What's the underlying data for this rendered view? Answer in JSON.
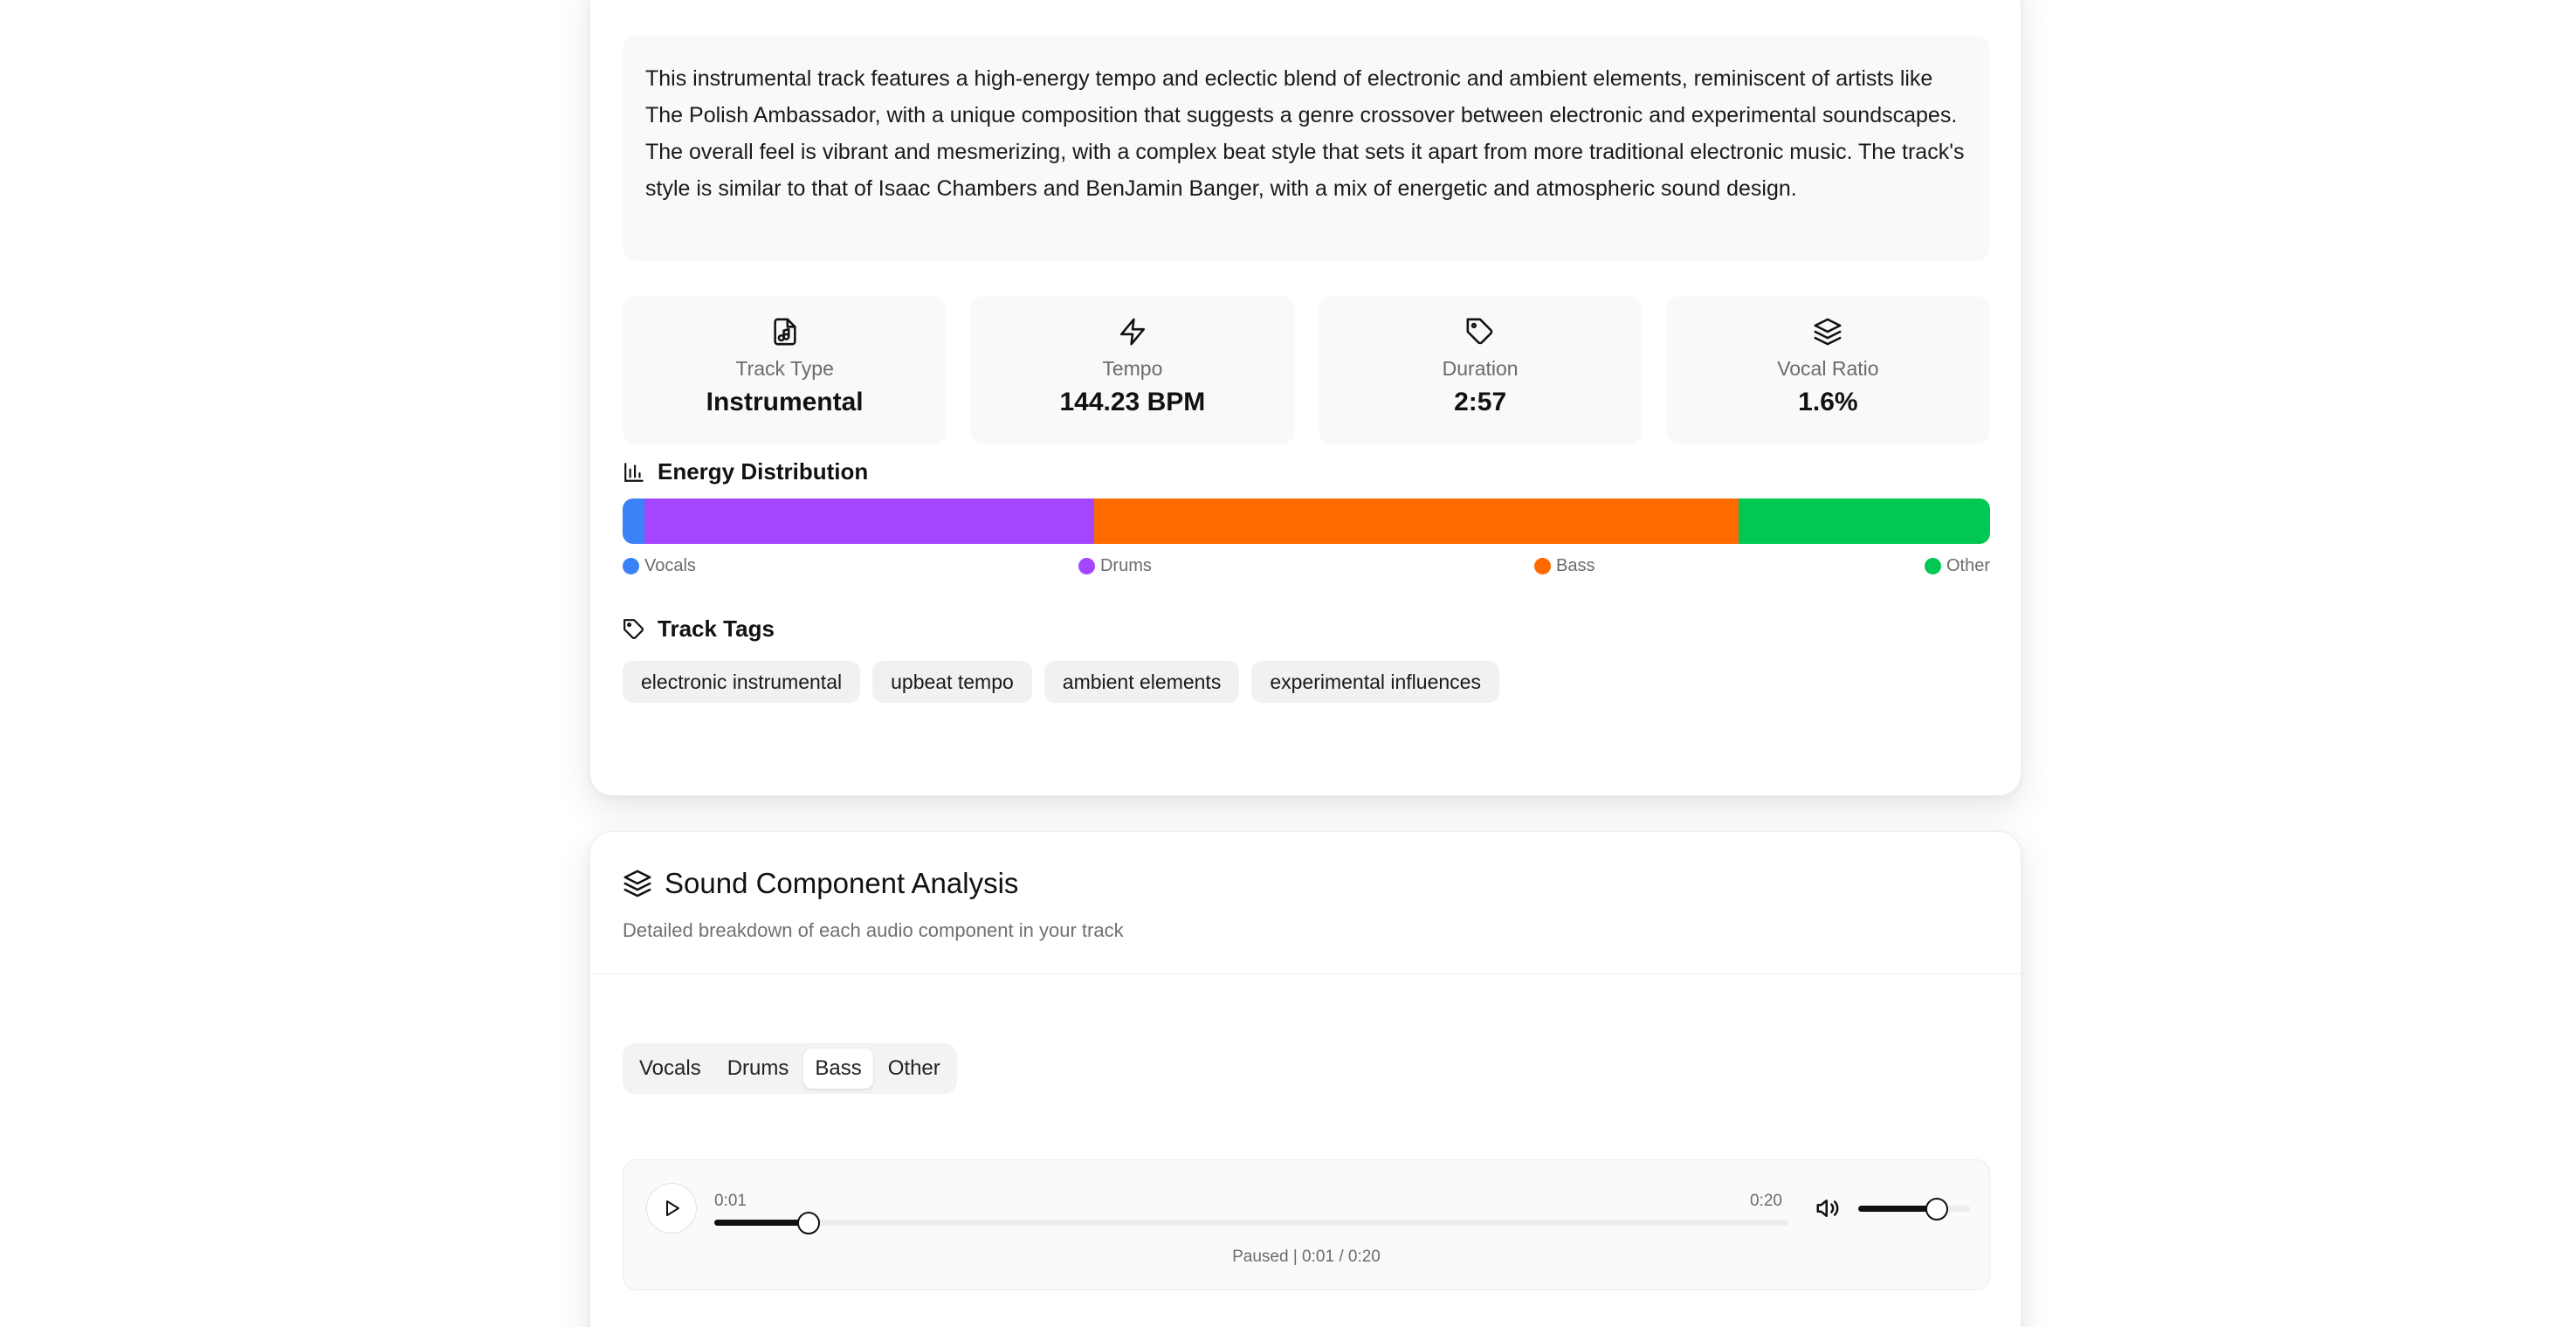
{
  "overview": {
    "description": "This instrumental track features a high-energy tempo and eclectic blend of electronic and ambient elements, reminiscent of artists like The Polish Ambassador, with a unique composition that suggests a genre crossover between electronic and experimental soundscapes. The overall feel is vibrant and mesmerizing, with a complex beat style that sets it apart from more traditional electronic music. The track's style is similar to that of Isaac Chambers and BenJamin Banger, with a mix of energetic and atmospheric sound design.",
    "stats": [
      {
        "icon": "music-file-icon",
        "label": "Track Type",
        "value": "Instrumental"
      },
      {
        "icon": "lightning-icon",
        "label": "Tempo",
        "value": "144.23 BPM"
      },
      {
        "icon": "tag-icon",
        "label": "Duration",
        "value": "2:57"
      },
      {
        "icon": "layers-icon",
        "label": "Vocal Ratio",
        "value": "1.6%"
      }
    ]
  },
  "energy": {
    "title": "Energy Distribution",
    "segments": [
      {
        "name": "Vocals",
        "share": 1.6,
        "color": "#3b82f6"
      },
      {
        "name": "Drums",
        "share": 32.9,
        "color": "#a347ff"
      },
      {
        "name": "Bass",
        "share": 47.1,
        "color": "#ff6a00"
      },
      {
        "name": "Other",
        "share": 18.4,
        "color": "#00c853"
      }
    ]
  },
  "tags": {
    "title": "Track Tags",
    "items": [
      "electronic instrumental",
      "upbeat tempo",
      "ambient elements",
      "experimental influences"
    ]
  },
  "analysis": {
    "title": "Sound Component Analysis",
    "subtitle": "Detailed breakdown of each audio component in your track",
    "tabs": [
      "Vocals",
      "Drums",
      "Bass",
      "Other"
    ],
    "active_tab": "Bass"
  },
  "player": {
    "current_time": "0:01",
    "end_time": "0:20",
    "progress_fraction": 0.088,
    "volume_fraction": 0.7,
    "status": "Paused | 0:01 / 0:20"
  }
}
